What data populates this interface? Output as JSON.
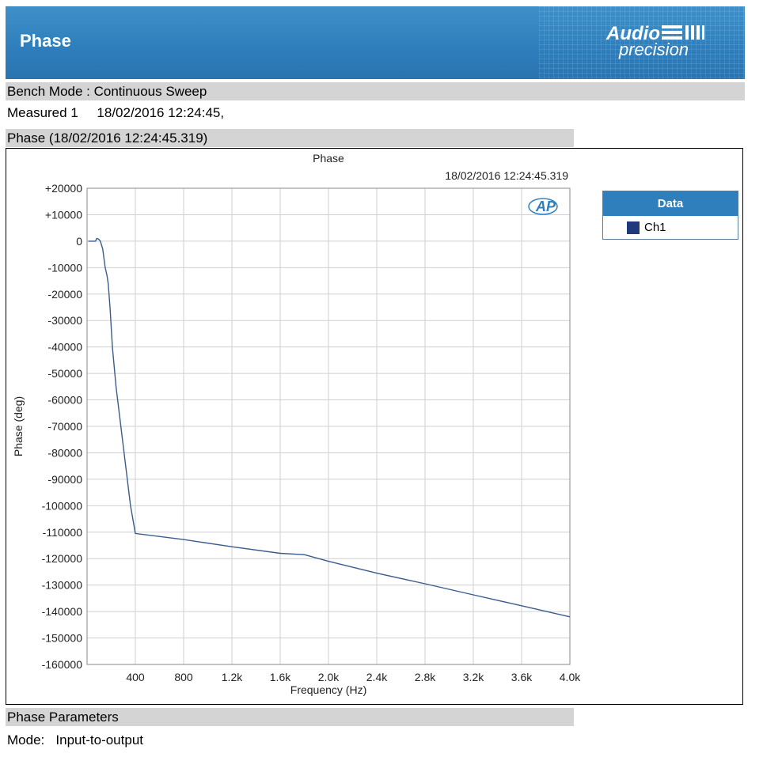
{
  "header": {
    "title": "Phase",
    "logo_top": "Audio",
    "logo_bottom": "precision"
  },
  "bench_mode": "Bench Mode : Continuous Sweep",
  "measured": {
    "label": "Measured 1",
    "timestamp": "18/02/2016 12:24:45,"
  },
  "graph_section_title": "Phase (18/02/2016 12:24:45.319)",
  "parameters": {
    "title": "Phase Parameters",
    "mode_label": "Mode:",
    "mode_value": "Input-to-output"
  },
  "legend": {
    "title": "Data",
    "entries": [
      {
        "label": "Ch1",
        "color": "#1f3a7a"
      }
    ]
  },
  "colors": {
    "accent": "#2f7fbc",
    "series": "#3b5b8c",
    "section_bar": "#d4d4d4"
  },
  "chart_data": {
    "type": "line",
    "title": "Phase",
    "timestamp": "18/02/2016 12:24:45.319",
    "watermark": "AP",
    "xlabel": "Frequency (Hz)",
    "ylabel": "Phase (deg)",
    "xlim": [
      0,
      4000
    ],
    "ylim": [
      -160000,
      20000
    ],
    "x_ticks": [
      400,
      800,
      1200,
      1600,
      2000,
      2400,
      2800,
      3200,
      3600,
      4000
    ],
    "x_tick_labels": [
      "400",
      "800",
      "1.2k",
      "1.6k",
      "2.0k",
      "2.4k",
      "2.8k",
      "3.2k",
      "3.6k",
      "4.0k"
    ],
    "y_ticks": [
      20000,
      10000,
      0,
      -10000,
      -20000,
      -30000,
      -40000,
      -50000,
      -60000,
      -70000,
      -80000,
      -90000,
      -100000,
      -110000,
      -120000,
      -130000,
      -140000,
      -150000,
      -160000
    ],
    "y_tick_labels": [
      "+20000",
      "+10000",
      "0",
      "-10000",
      "-20000",
      "-30000",
      "-40000",
      "-50000",
      "-60000",
      "-70000",
      "-80000",
      "-90000",
      "-100000",
      "-110000",
      "-120000",
      "-130000",
      "-140000",
      "-150000",
      "-160000"
    ],
    "grid": true,
    "legend_position": "right",
    "series": [
      {
        "name": "Ch1",
        "color": "#3b5b8c",
        "x": [
          10,
          40,
          70,
          80,
          95,
          110,
          130,
          150,
          165,
          175,
          190,
          210,
          240,
          280,
          320,
          360,
          400,
          800,
          1200,
          1600,
          1800,
          2000,
          2400,
          2800,
          3200,
          3600,
          4000
        ],
        "y": [
          0,
          0,
          0,
          1000,
          800,
          0,
          -3000,
          -10000,
          -13000,
          -16000,
          -25000,
          -40000,
          -55000,
          -70000,
          -85000,
          -100000,
          -110500,
          -112800,
          -115500,
          -118000,
          -118500,
          -121000,
          -125500,
          -129500,
          -133700,
          -137800,
          -142000
        ]
      }
    ]
  }
}
